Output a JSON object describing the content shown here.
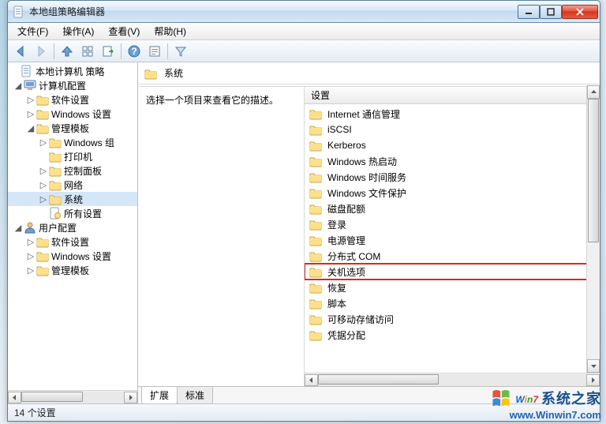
{
  "title": "本地组策略编辑器",
  "menus": [
    "文件(F)",
    "操作(A)",
    "查看(V)",
    "帮助(H)"
  ],
  "tree": {
    "root": "本地计算机 策略",
    "computer_cfg": "计算机配置",
    "software_settings": "软件设置",
    "windows_settings": "Windows 设置",
    "admin_templates": "管理模板",
    "windows_components": "Windows 组",
    "printer": "打印机",
    "control_panel": "控制面板",
    "network": "网络",
    "system": "系统",
    "all_settings": "所有设置",
    "user_cfg": "用户配置",
    "u_software_settings": "软件设置",
    "u_windows_settings": "Windows 设置",
    "u_admin_templates": "管理模板"
  },
  "header_title": "系统",
  "desc_text": "选择一个项目来查看它的描述。",
  "list_header": "设置",
  "items": [
    "Internet 通信管理",
    "iSCSI",
    "Kerberos",
    "Windows 热启动",
    "Windows 时间服务",
    "Windows 文件保护",
    "磁盘配额",
    "登录",
    "电源管理",
    "分布式 COM",
    "关机选项",
    "恢复",
    "脚本",
    "可移动存储访问",
    "凭据分配"
  ],
  "highlight_index": 10,
  "tabs": {
    "extended": "扩展",
    "standard": "标准"
  },
  "status": "14 个设置",
  "watermark": {
    "brand_cn": "系统之家",
    "url": "www.Winwin7.com"
  }
}
